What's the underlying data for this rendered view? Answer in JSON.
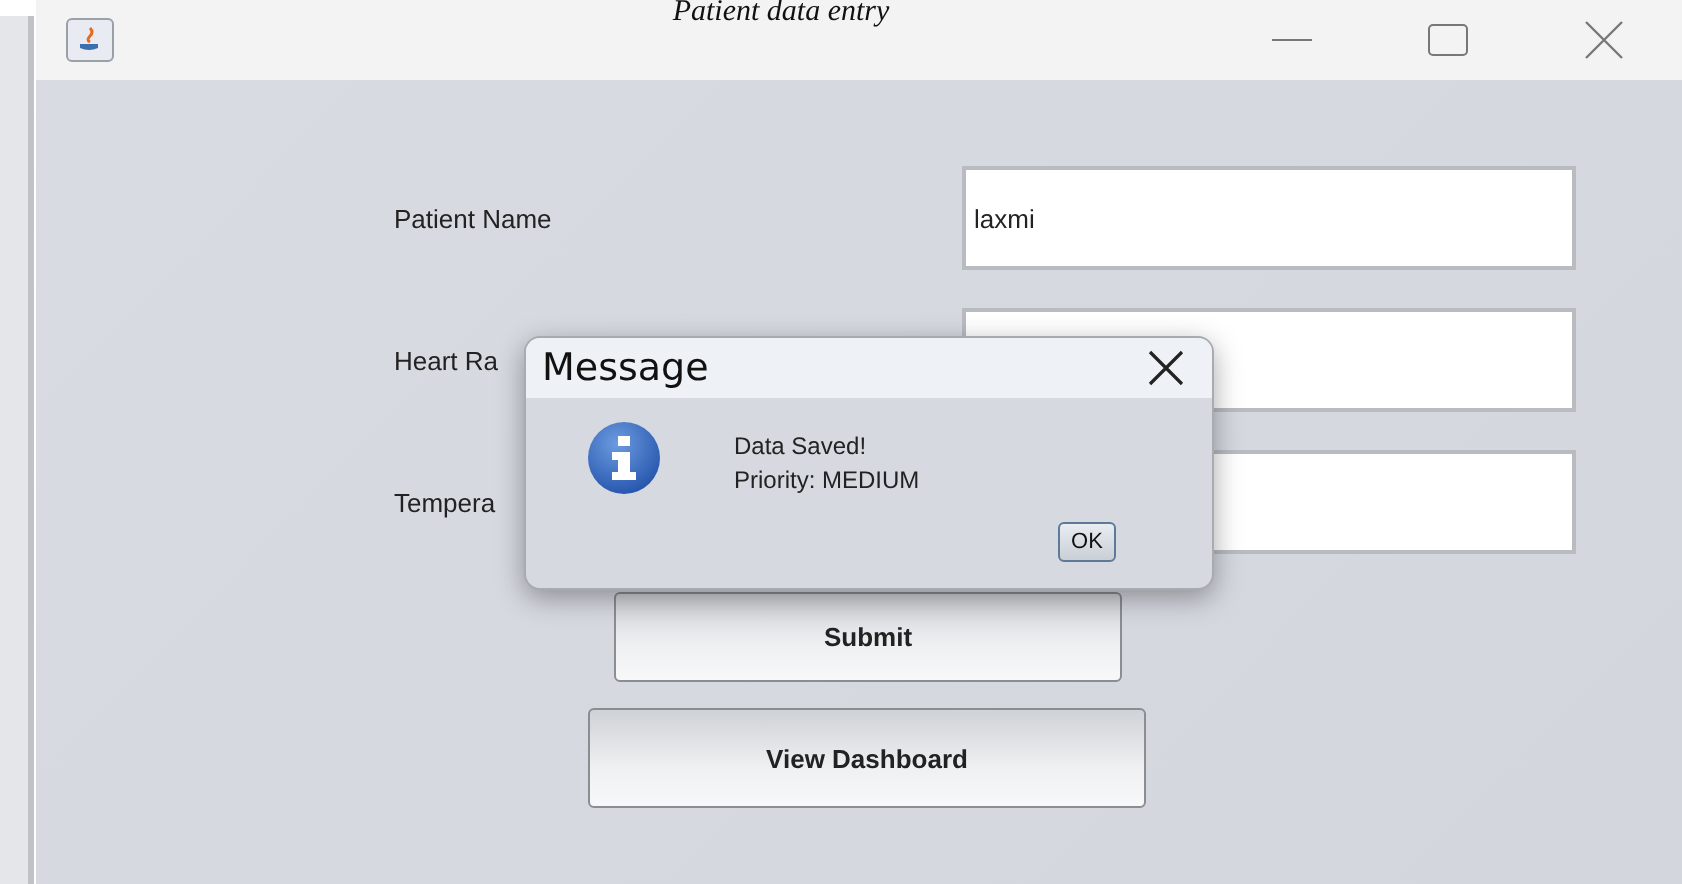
{
  "caption": "Patient data entry",
  "form": {
    "fields": [
      {
        "label": "Patient Name",
        "value": "laxmi"
      },
      {
        "label": "Heart Ra"
      },
      {
        "label": "Tempera"
      }
    ],
    "buttons": [
      {
        "label": "Submit",
        "kind": "narrow"
      },
      {
        "label": "View Dashboard",
        "kind": "wide"
      }
    ]
  },
  "dialog": {
    "title": "Message",
    "lines": [
      "Data Saved!",
      "Priority: MEDIUM"
    ],
    "button": "OK"
  }
}
